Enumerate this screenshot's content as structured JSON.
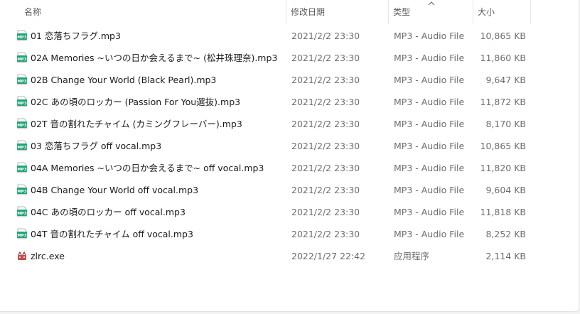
{
  "columns": {
    "name": "名称",
    "date": "修改日期",
    "type": "类型",
    "size": "大小"
  },
  "files": [
    {
      "icon": "mp3-file-icon",
      "name": "01 恋落ちフラグ.mp3",
      "date": "2021/2/2 23:30",
      "type": "MP3 - Audio File",
      "size": "10,865 KB"
    },
    {
      "icon": "mp3-file-icon",
      "name": "02A Memories ~いつの日か会えるまで~ (松井珠理奈).mp3",
      "date": "2021/2/2 23:30",
      "type": "MP3 - Audio File",
      "size": "11,860 KB"
    },
    {
      "icon": "mp3-file-icon",
      "name": "02B Change Your World (Black Pearl).mp3",
      "date": "2021/2/2 23:30",
      "type": "MP3 - Audio File",
      "size": "9,647 KB"
    },
    {
      "icon": "mp3-file-icon",
      "name": "02C あの頃のロッカー (Passion For You選抜).mp3",
      "date": "2021/2/2 23:30",
      "type": "MP3 - Audio File",
      "size": "11,872 KB"
    },
    {
      "icon": "mp3-file-icon",
      "name": "02T 音の割れたチャイム (カミングフレーバー).mp3",
      "date": "2021/2/2 23:30",
      "type": "MP3 - Audio File",
      "size": "8,170 KB"
    },
    {
      "icon": "mp3-file-icon",
      "name": "03 恋落ちフラグ off vocal.mp3",
      "date": "2021/2/2 23:30",
      "type": "MP3 - Audio File",
      "size": "10,865 KB"
    },
    {
      "icon": "mp3-file-icon",
      "name": "04A Memories ~いつの日か会えるまで~ off vocal.mp3",
      "date": "2021/2/2 23:30",
      "type": "MP3 - Audio File",
      "size": "11,820 KB"
    },
    {
      "icon": "mp3-file-icon",
      "name": "04B Change Your World off vocal.mp3",
      "date": "2021/2/2 23:30",
      "type": "MP3 - Audio File",
      "size": "9,604 KB"
    },
    {
      "icon": "mp3-file-icon",
      "name": "04C あの頃のロッカー off vocal.mp3",
      "date": "2021/2/2 23:30",
      "type": "MP3 - Audio File",
      "size": "11,818 KB"
    },
    {
      "icon": "mp3-file-icon",
      "name": "04T 音の割れたチャイム off vocal.mp3",
      "date": "2021/2/2 23:30",
      "type": "MP3 - Audio File",
      "size": "8,252 KB"
    },
    {
      "icon": "exe-app-icon",
      "name": "zlrc.exe",
      "date": "2022/1/27 22:42",
      "type": "应用程序",
      "size": "2,114 KB"
    }
  ],
  "colors": {
    "mp3_icon_bg": "#1fa574",
    "exe_icon": "#c0504d"
  }
}
